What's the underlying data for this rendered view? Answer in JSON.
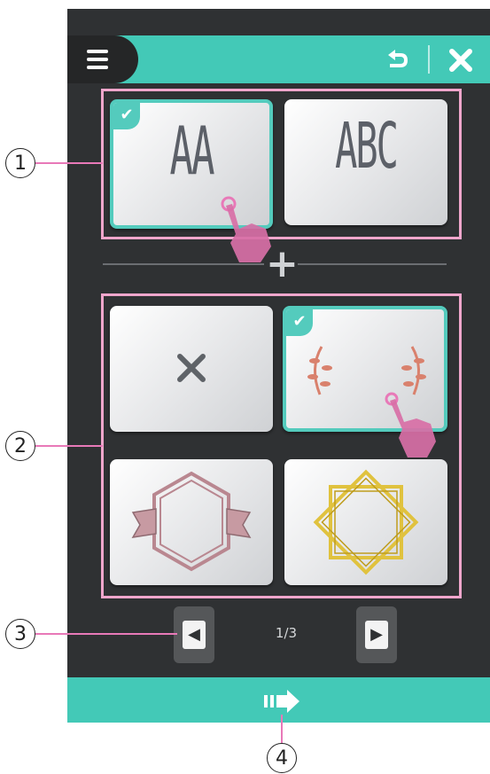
{
  "header": {
    "menu_icon": "hamburger-menu-icon",
    "undo_icon": "undo-arrow-icon",
    "close_icon": "close-x-icon"
  },
  "fonts_group": {
    "items": [
      {
        "name": "monogram-font-1",
        "sample": "AA",
        "selected": true
      },
      {
        "name": "monogram-font-2",
        "sample": "ABC",
        "selected": false
      }
    ]
  },
  "frames_group": {
    "items": [
      {
        "name": "no-frame",
        "icon": "x-icon",
        "selected": false
      },
      {
        "name": "laurel-frame",
        "icon": "laurel-branches",
        "selected": true
      },
      {
        "name": "hexagon-banner-frame",
        "icon": "hexagon-banner",
        "selected": false
      },
      {
        "name": "octagram-frame",
        "icon": "octagram-star",
        "selected": false
      }
    ]
  },
  "pagination": {
    "prev_icon": "arrow-left-icon",
    "next_icon": "arrow-right-icon",
    "current": "1/3"
  },
  "footer": {
    "next_icon": "proceed-arrow-icon"
  },
  "callouts": {
    "c1": "1",
    "c2": "2",
    "c3": "3",
    "c4": "4"
  },
  "colors": {
    "accent": "#43c9b7",
    "outline": "#f0a6cc",
    "background": "#2f3133"
  }
}
